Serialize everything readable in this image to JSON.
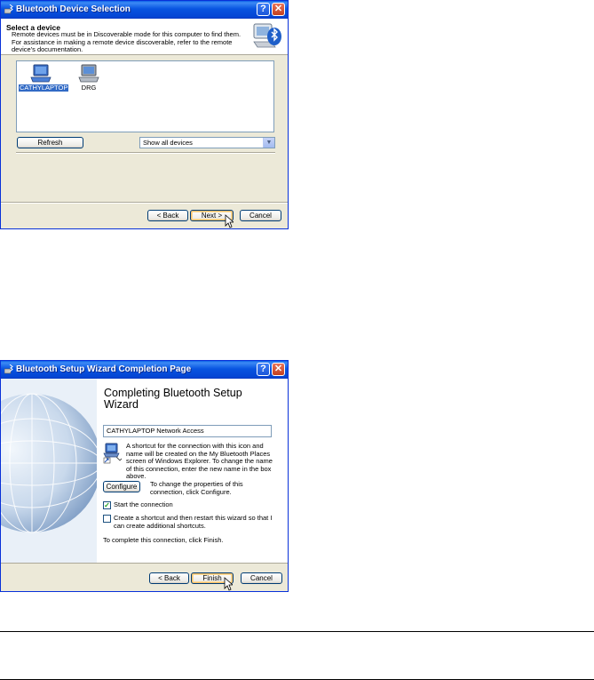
{
  "window1": {
    "title": "Bluetooth Device Selection",
    "header_title": "Select a device",
    "header_desc": "Remote devices must be in Discoverable mode for this computer to find them. For assistance in making a remote device discoverable, refer to the remote device's documentation.",
    "devices": [
      {
        "label": "CATHYLAPTOP",
        "selected": true
      },
      {
        "label": "DRG",
        "selected": false
      }
    ],
    "refresh_label": "Refresh",
    "filter_value": "Show all devices",
    "back_label": "< Back",
    "next_label": "Next >",
    "cancel_label": "Cancel"
  },
  "window2": {
    "title": "Bluetooth Setup Wizard Completion Page",
    "heading": "Completing Bluetooth Setup Wizard",
    "connection_name": "CATHYLAPTOP Network Access",
    "shortcut_text": "A shortcut for the connection with this icon and name will be created on the My Bluetooth Places screen of Windows Explorer. To change the name of this connection, enter the new name in the box above.",
    "configure_label": "Configure",
    "configure_text": "To change the properties of this connection, click Configure.",
    "start_connection_label": "Start the connection",
    "start_connection_checked": true,
    "create_shortcut_label": "Create a shortcut and then restart this wizard so that I can create additional shortcuts.",
    "create_shortcut_checked": false,
    "finish_text": "To complete this connection, click Finish.",
    "back_label": "< Back",
    "finish_label": "Finish",
    "cancel_label": "Cancel"
  },
  "colors": {
    "titlebar": "#0854e0",
    "dialog_bg": "#ece9d8",
    "selection": "#316ac5"
  }
}
